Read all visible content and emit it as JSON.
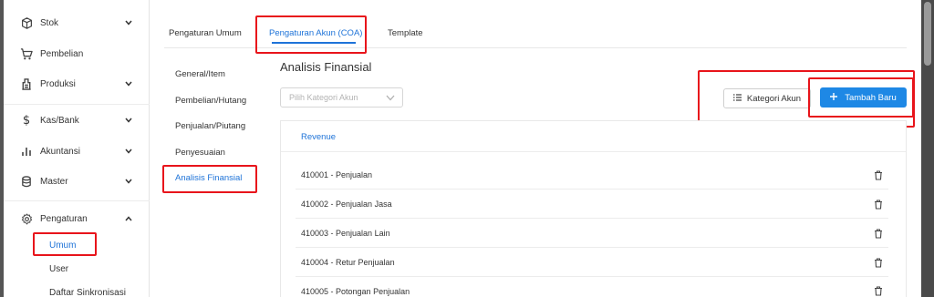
{
  "sidebar": {
    "items": [
      {
        "label": "Stok",
        "icon": "box-icon",
        "has_chevron": true
      },
      {
        "label": "Pembelian",
        "icon": "cart-icon",
        "has_chevron": false
      },
      {
        "label": "Produksi",
        "icon": "factory-icon",
        "has_chevron": true
      },
      {
        "label": "Kas/Bank",
        "icon": "dollar-icon",
        "has_chevron": true
      },
      {
        "label": "Akuntansi",
        "icon": "bar-chart-icon",
        "has_chevron": true
      },
      {
        "label": "Master",
        "icon": "database-icon",
        "has_chevron": true
      },
      {
        "label": "Pengaturan",
        "icon": "gear-icon",
        "has_chevron": true,
        "expanded": true
      }
    ],
    "sub_items": [
      {
        "label": "Umum",
        "active": true
      },
      {
        "label": "User",
        "active": false
      },
      {
        "label": "Daftar Sinkronisasi",
        "active": false
      }
    ]
  },
  "tabs": [
    {
      "label": "Pengaturan Umum",
      "active": false
    },
    {
      "label": "Pengaturan Akun (COA)",
      "active": true
    },
    {
      "label": "Template",
      "active": false
    }
  ],
  "submenu": [
    {
      "label": "General/Item",
      "active": false
    },
    {
      "label": "Pembelian/Hutang",
      "active": false
    },
    {
      "label": "Penjualan/Piutang",
      "active": false
    },
    {
      "label": "Penyesuaian",
      "active": false
    },
    {
      "label": "Analisis Finansial",
      "active": true
    }
  ],
  "main": {
    "title": "Analisis Finansial",
    "category_select_placeholder": "Pilih Kategori Akun",
    "kategori_button": "Kategori Akun",
    "add_button": "Tambah Baru",
    "category_header": "Revenue",
    "rows": [
      "410001 - Penjualan",
      "410002 - Penjualan Jasa",
      "410003 - Penjualan Lain",
      "410004 - Retur Penjualan",
      "410005 - Potongan Penjualan"
    ]
  },
  "colors": {
    "accent": "#1e73d8",
    "primary_button": "#1e88e5",
    "highlight_box": "#e8141b"
  }
}
